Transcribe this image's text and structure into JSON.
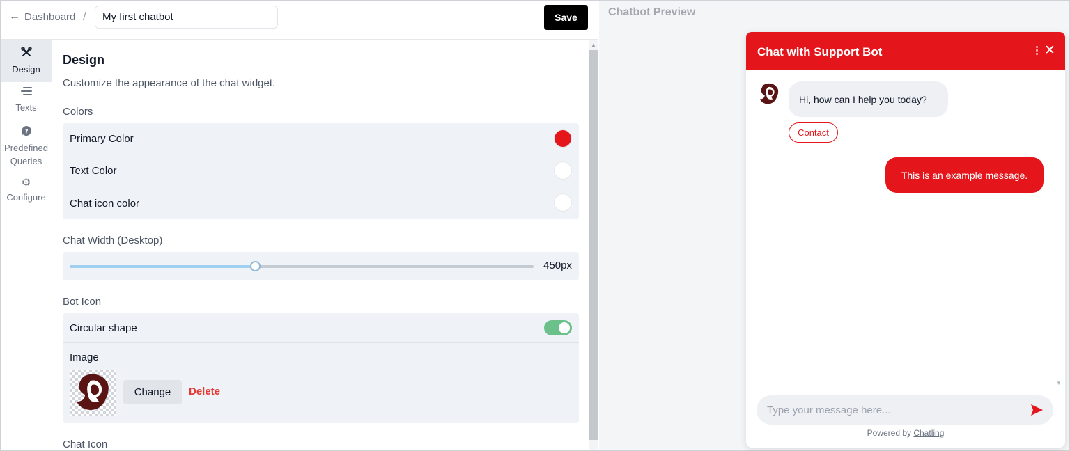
{
  "header": {
    "back_label": "Dashboard",
    "separator": "/",
    "chatbot_name": "My first chatbot",
    "save_label": "Save"
  },
  "sidebar": {
    "items": [
      {
        "label": "Design",
        "icon": "design-tools-icon",
        "active": true
      },
      {
        "label": "Texts",
        "icon": "text-lines-icon",
        "active": false
      },
      {
        "label": "Predefined Queries",
        "icon": "question-bubble-icon",
        "active": false
      },
      {
        "label": "Configure",
        "icon": "gear-icon",
        "active": false
      }
    ]
  },
  "design": {
    "title": "Design",
    "description": "Customize the appearance of the chat widget.",
    "colors_label": "Colors",
    "colors": [
      {
        "label": "Primary Color",
        "value": "#e4161b"
      },
      {
        "label": "Text Color",
        "value": "#ffffff"
      },
      {
        "label": "Chat icon color",
        "value": "#ffffff"
      }
    ],
    "width_label": "Chat Width (Desktop)",
    "width_value": "450px",
    "width_fraction": 0.4,
    "bot_icon_label": "Bot Icon",
    "circular_label": "Circular shape",
    "circular_on": true,
    "image_label": "Image",
    "change_label": "Change",
    "delete_label": "Delete",
    "chat_icon_label": "Chat Icon"
  },
  "preview": {
    "title": "Chatbot Preview",
    "widget_title": "Chat with Support Bot",
    "bot_message": "Hi, how can I help you today?",
    "contact_label": "Contact",
    "user_message": "This is an example message.",
    "input_placeholder": "Type your message here...",
    "powered_prefix": "Powered by",
    "powered_link": "Chatling"
  },
  "colors": {
    "primary": "#e4161b",
    "toggle": "#6cc18b",
    "save_button": "#000000"
  }
}
